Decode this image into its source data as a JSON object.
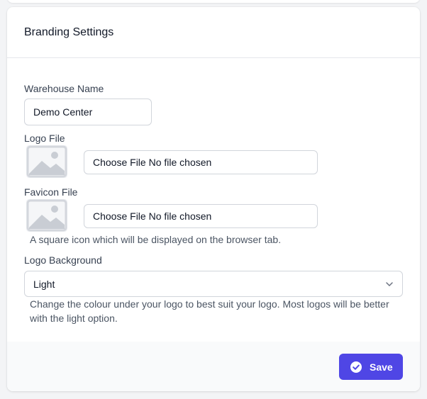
{
  "card": {
    "title": "Branding Settings"
  },
  "warehouse_name": {
    "label": "Warehouse Name",
    "value": "Demo Center"
  },
  "logo_file": {
    "label": "Logo File",
    "button_text": "Choose File No file chosen"
  },
  "favicon_file": {
    "label": "Favicon File",
    "button_text": "Choose File No file chosen",
    "help": "A square icon which will be displayed on the browser tab."
  },
  "logo_background": {
    "label": "Logo Background",
    "selected": "Light",
    "help": "Change the colour under your logo to best suit your logo. Most logos will be better with the light option."
  },
  "footer": {
    "save_label": "Save"
  },
  "colors": {
    "accent": "#4f46e5",
    "border": "#d1d5db",
    "placeholder_image": "#eef0f3"
  },
  "icons": {
    "logo_thumb": "image-placeholder-icon",
    "favicon_thumb": "image-placeholder-icon",
    "select": "chevron-down-icon",
    "save": "check-circle-icon"
  }
}
